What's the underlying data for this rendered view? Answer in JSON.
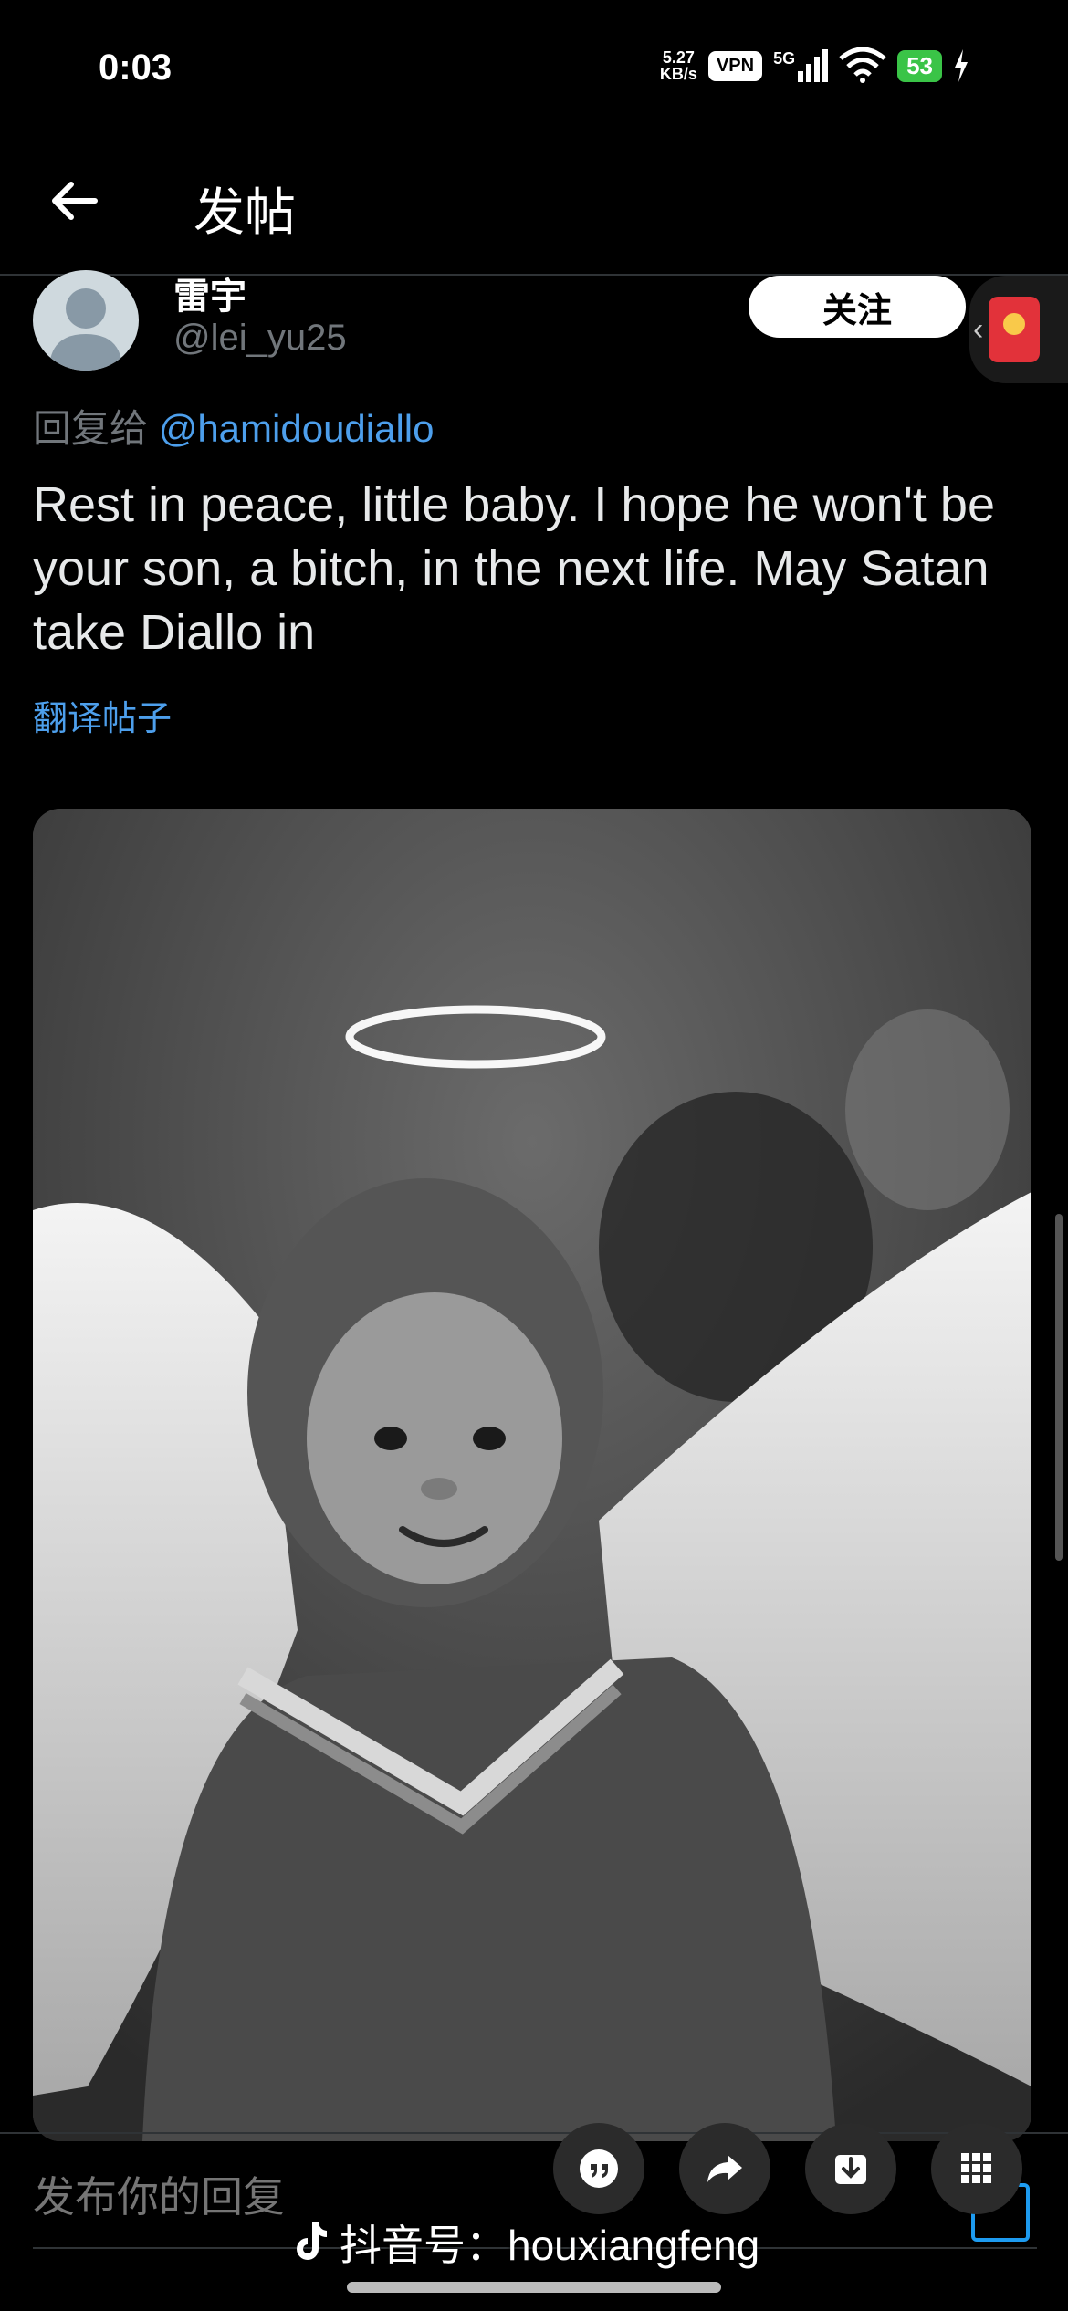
{
  "status_bar": {
    "time": "0:03",
    "speed_value": "5.27",
    "speed_unit": "KB/s",
    "vpn": "VPN",
    "network": "5G",
    "battery": "53"
  },
  "header": {
    "title": "发帖"
  },
  "post": {
    "author_name": "雷宇",
    "author_handle": "@lei_yu25",
    "follow_label": "关注",
    "reply_prefix": "回复给",
    "reply_mention": "@hamidoudiallo",
    "text": "Rest in peace, little baby. I hope he won't be your son, a bitch, in the next life. May Satan take Diallo in",
    "translate_label": "翻译帖子"
  },
  "reply_bar": {
    "placeholder": "发布你的回复"
  },
  "watermark": {
    "text": "抖音号：houxiangfeng"
  },
  "colors": {
    "background": "#000000",
    "link": "#4d9fec",
    "muted": "#71767b",
    "battery": "#3ac447"
  }
}
